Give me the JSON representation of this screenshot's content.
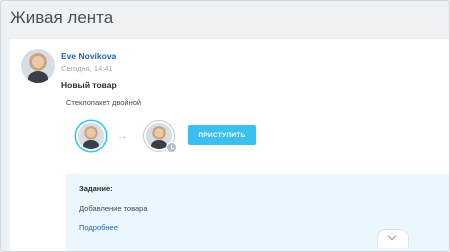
{
  "header": {
    "title": "Живая лента"
  },
  "post": {
    "author": "Eve Novikova",
    "time": "Сегодня, 14:41",
    "title": "Новый товар",
    "text": "Стеклопакет двойной"
  },
  "workflow": {
    "arrow": "→",
    "start_button_label": "ПРИСТУПИТЬ",
    "icons": [
      "user-avatar",
      "arrow-right-icon",
      "user-avatar",
      "clock-icon"
    ],
    "accent_color": "#39c0ef"
  },
  "task": {
    "label": "Задание:",
    "value": "Добавление товара",
    "more_link": "Подробнее"
  },
  "colors": {
    "link": "#2067b0",
    "task_background": "#eaf7fd",
    "page_background": "#eef2f4"
  }
}
